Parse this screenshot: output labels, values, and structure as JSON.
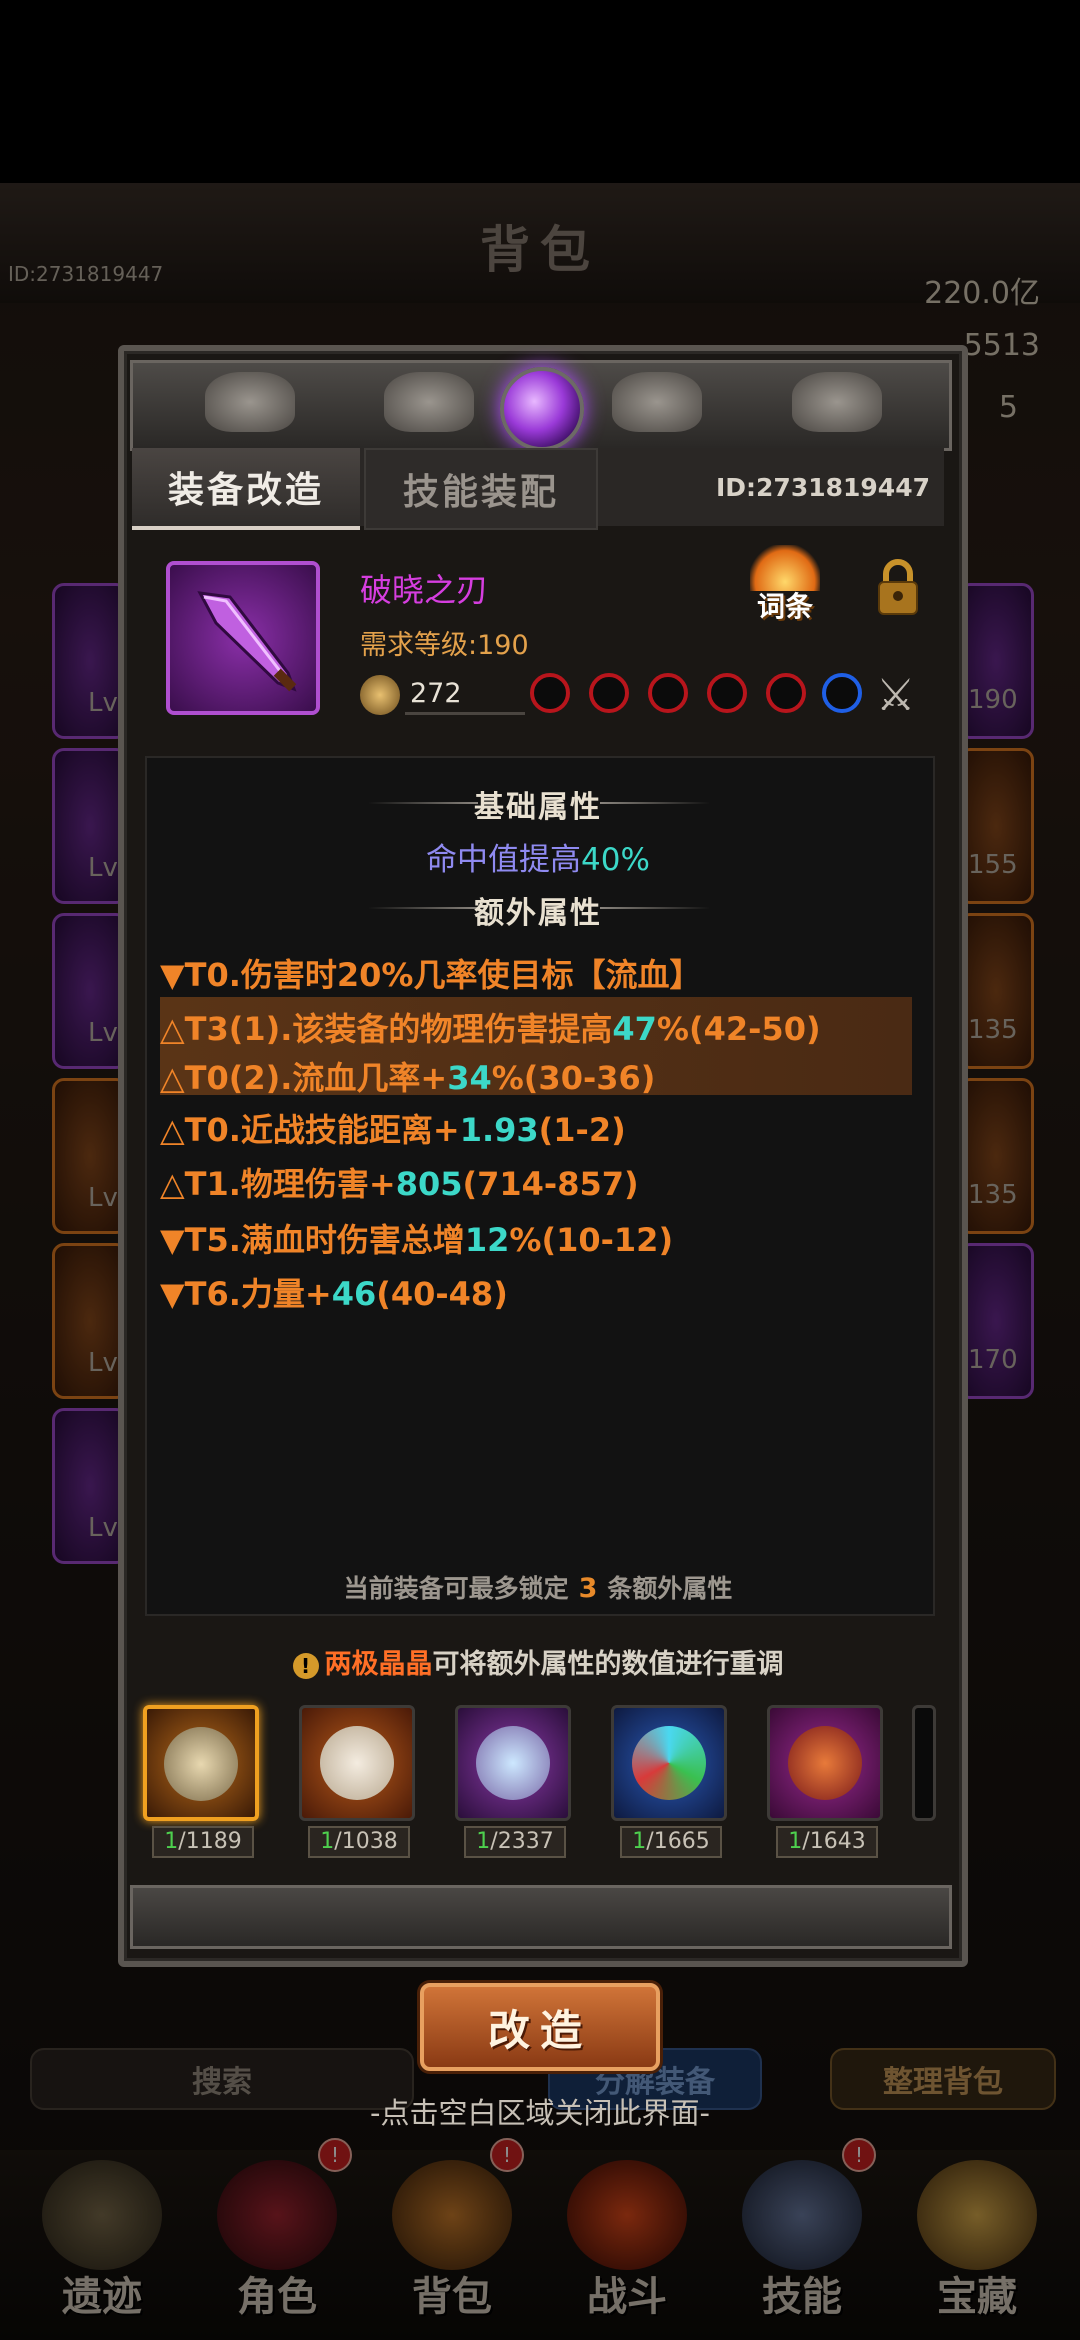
{
  "background": {
    "title": "背包",
    "player_id": "ID:2731819447",
    "gold": "220.0亿",
    "gems": "5513",
    "third_resource": "5",
    "side_levels": [
      "190",
      "155",
      "135",
      "135",
      "170"
    ],
    "left_lv": [
      "Lv",
      "Lv",
      "Lv",
      "Lv",
      "Lv",
      "Lv"
    ],
    "search_label": "搜索",
    "decompose_label": "分解装备",
    "sort_label": "整理背包",
    "nav": [
      "遗迹",
      "角色",
      "背包",
      "战斗",
      "技能",
      "宝藏"
    ],
    "nav_badge": "!"
  },
  "modal": {
    "tabs": {
      "active": "装备改造",
      "inactive": "技能装配"
    },
    "id_label": "ID:2731819447",
    "item": {
      "name": "破晓之刃",
      "requirement": "需求等级:190",
      "power": "272",
      "sockets": [
        "red",
        "red",
        "red",
        "red",
        "red",
        "blue"
      ],
      "entry_label": "词条",
      "name_color": "#d63ee0"
    },
    "base_section_title": "基础属性",
    "base_attr": {
      "text": "命中值提高",
      "value": "40%"
    },
    "extra_section_title": "额外属性",
    "stats": [
      {
        "prefix": "▼T0.伤害时20%几率使目标【流血】",
        "num": "",
        "suffix": ""
      },
      {
        "prefix": "△T3(1).该装备的物理伤害提高",
        "num": "47",
        "suffix": "%(42-50)"
      },
      {
        "prefix": "△T0(2).流血几率+",
        "num": "34",
        "suffix": "%(30-36)"
      },
      {
        "prefix": "△T0.近战技能距离+",
        "num": "1.93",
        "suffix": "(1-2)"
      },
      {
        "prefix": "△T1.物理伤害+",
        "num": "805",
        "suffix": "(714-857)"
      },
      {
        "prefix": "▼T5.满血时伤害总增",
        "num": "12",
        "suffix": "%(10-12)"
      },
      {
        "prefix": "▼T6.力量+",
        "num": "46",
        "suffix": "(40-48)"
      }
    ],
    "lock_info": {
      "before": "当前装备可最多锁定",
      "count": "3",
      "after": "条额外属性"
    },
    "crystal_hint": {
      "icon": "!",
      "name": "两极晶晶",
      "text": "可将额外属性的数值进行重调"
    },
    "materials": [
      {
        "have": "1",
        "total": "/1189",
        "icon": "yin-yang-orb-icon"
      },
      {
        "have": "1",
        "total": "/1038",
        "icon": "twin-masks-icon"
      },
      {
        "have": "1",
        "total": "/2337",
        "icon": "crystal-cluster-icon"
      },
      {
        "have": "1",
        "total": "/1665",
        "icon": "prism-ore-icon"
      },
      {
        "have": "1",
        "total": "/1643",
        "icon": "red-ore-icon"
      }
    ],
    "reforge_button": "改造",
    "close_hint": "-点击空白区域关闭此界面-"
  }
}
